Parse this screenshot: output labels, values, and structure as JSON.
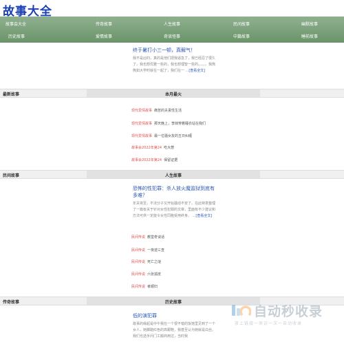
{
  "site": {
    "title": "故事大全"
  },
  "nav": {
    "row1": [
      "故事会大全",
      "传奇故事",
      "人生故事",
      "民间故事",
      "幽默故事"
    ],
    "row2": [
      "历史故事",
      "爱情故事",
      "奇谈怪事",
      "中篇故事",
      "睡前故事"
    ]
  },
  "featured": {
    "headline": "终于暑打小三一顿，真解气！",
    "excerpt": "我不是凶妇，真的是他们把我逼急了，我已经忍了很久了，我也想优雅一些的，我也想理智一些的。。。。。我熊熊如大学时就在一起了，我们在一 ...",
    "more": "[查看全文]"
  },
  "section1": {
    "left_title": "最新故事",
    "mid_title": "本月最火",
    "rows": [
      {
        "tag": "现代爱情故事",
        "text": "痛苦的夫妻性生活"
      },
      {
        "tag": "现代爱情故事",
        "text": "那天晚上，李妹穿着睡衣站在我们"
      },
      {
        "tag": "现代爱情故事",
        "text": "最一位骚女友的五日纠缠"
      },
      {
        "tag": "故事会2022年第24",
        "text": "吃大葱"
      },
      {
        "tag": "故事会2022年第24",
        "text": "保留证据"
      }
    ]
  },
  "section2": {
    "left_title": "民间故事",
    "mid_title": "人生故事",
    "headline": "恐怖的性犯罪：杀人放火魔监狱到底有多难？",
    "excerpt": "年关将至，不法分子又开始骚动不安了。在此特意整理了一篇有关于针对女性犯罪的文章，里面有不少建议和方法可供一定能令女性同胞受用终身。 ...",
    "more": "[查看全文]",
    "rows": [
      {
        "tag": "民间传说",
        "text": "教堂奇谈话"
      },
      {
        "tag": "民间传说",
        "text": "一夜迹三查"
      },
      {
        "tag": "民间传说",
        "text": "死亡之谜"
      },
      {
        "tag": "民间传说",
        "text": "六张孤皮"
      },
      {
        "tag": "民间传说",
        "text": "孝顺妇"
      }
    ]
  },
  "section3": {
    "left_title": "传奇故事",
    "mid_title": "历史故事",
    "headline": "低的演犯罪",
    "excerpt": "故事的缘起是中午我在一个很不错的饭馆里见到了一个女人，她脚踏红色的高跟鞋，我甚至认为她就是白丝。我们也选手问门工搬商用过，当时我"
  },
  "watermark": {
    "title": "自动秒收录",
    "subtitle": "放上链接一来访一次一自动收录"
  },
  "colors": {
    "nav_bg": "#7aa07a",
    "link": "#2a55b8",
    "tag": "#d9534f"
  }
}
